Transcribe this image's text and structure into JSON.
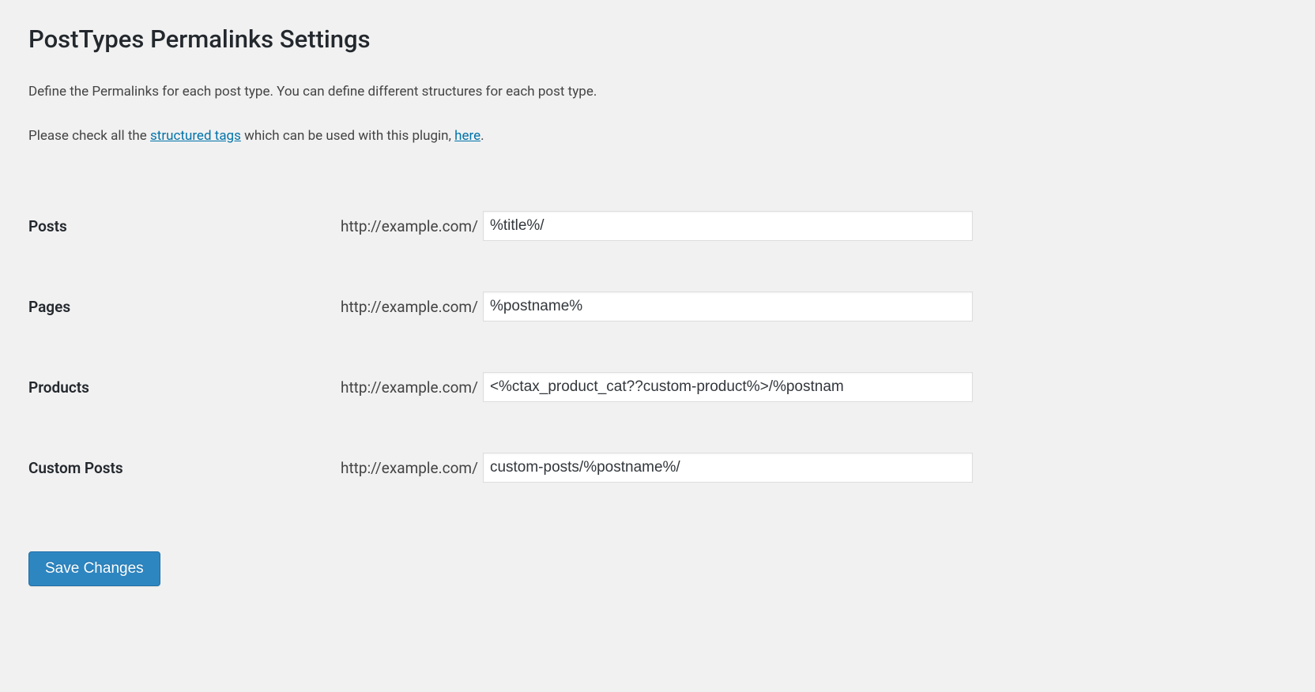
{
  "page": {
    "title": "PostTypes Permalinks Settings",
    "description1": "Define the Permalinks for each post type. You can define different structures for each post type.",
    "description2_prefix": "Please check all the ",
    "description2_link1": "structured tags",
    "description2_middle": " which can be used with this plugin, ",
    "description2_link2": "here",
    "description2_suffix": "."
  },
  "urlPrefix": "http://example.com/",
  "rows": [
    {
      "label": "Posts",
      "value": "%title%/"
    },
    {
      "label": "Pages",
      "value": "%postname%"
    },
    {
      "label": "Products",
      "value": "<%ctax_product_cat??custom-product%>/%postnam"
    },
    {
      "label": "Custom Posts",
      "value": "custom-posts/%postname%/"
    }
  ],
  "actions": {
    "save": "Save Changes"
  }
}
